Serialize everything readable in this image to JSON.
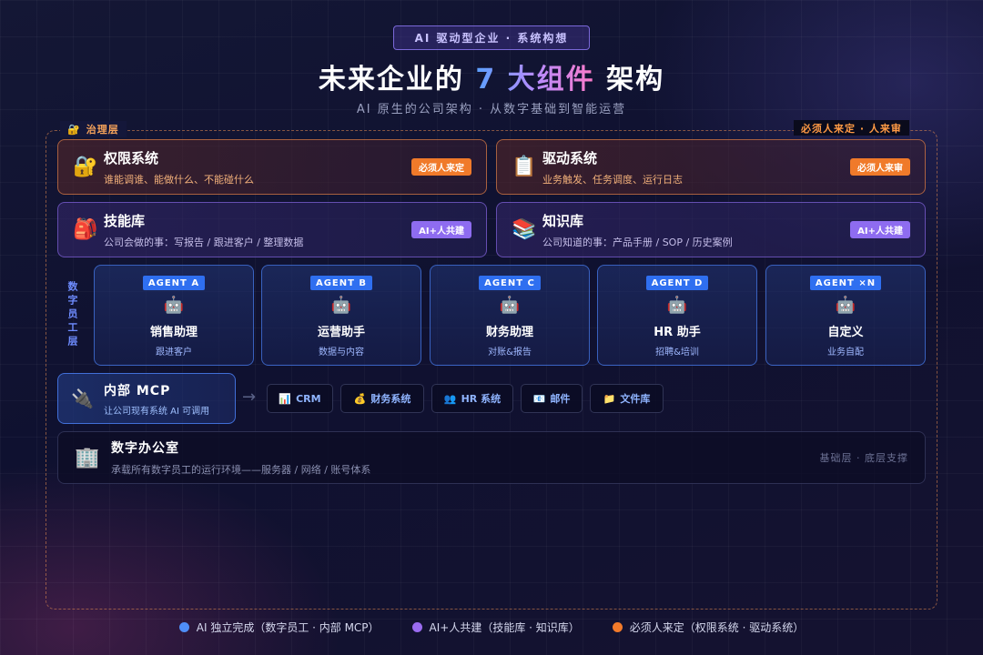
{
  "header": {
    "tag": "AI 驱动型企业 · 系统构想",
    "title_pre": "未来企业的 ",
    "title_highlight": "7 大组件",
    "title_post": " 架构",
    "subtitle": "AI 原生的公司架构 · 从数字基础到智能运营"
  },
  "governance": {
    "label": "治理层",
    "icon": "lock-key-icon",
    "note": "必须人来定 · 人来审",
    "cards": [
      {
        "icon": "🔐",
        "name": "权限系统",
        "desc": "谁能调谁、能做什么、不能碰什么",
        "badge": "必须人来定"
      },
      {
        "icon": "📋",
        "name": "驱动系统",
        "desc": "业务触发、任务调度、运行日志",
        "badge": "必须人来审"
      }
    ]
  },
  "knowledge": {
    "cards": [
      {
        "icon": "🎒",
        "name": "技能库",
        "desc": "公司会做的事：写报告 / 跟进客户 / 整理数据",
        "badge": "AI+人共建"
      },
      {
        "icon": "📚",
        "name": "知识库",
        "desc": "公司知道的事：产品手册 / SOP / 历史案例",
        "badge": "AI+人共建"
      }
    ]
  },
  "agents": {
    "layer_label": "数字员工层",
    "items": [
      {
        "tag": "AGENT A",
        "icon": "🤖",
        "name": "销售助理",
        "desc": "跟进客户"
      },
      {
        "tag": "AGENT B",
        "icon": "🤖",
        "name": "运营助手",
        "desc": "数据与内容"
      },
      {
        "tag": "AGENT C",
        "icon": "🤖",
        "name": "财务助理",
        "desc": "对账&报告"
      },
      {
        "tag": "AGENT D",
        "icon": "🤖",
        "name": "HR 助手",
        "desc": "招聘&培训"
      },
      {
        "tag": "AGENT ×N",
        "icon": "🤖",
        "name": "自定义",
        "desc": "业务自配"
      }
    ]
  },
  "mcp": {
    "icon": "🔌",
    "name": "内部 MCP",
    "desc": "让公司现有系统 AI 可调用",
    "arrow": "→",
    "tools": [
      {
        "icon": "📊",
        "label": "CRM"
      },
      {
        "icon": "💰",
        "label": "财务系统"
      },
      {
        "icon": "👥",
        "label": "HR 系统"
      },
      {
        "icon": "📧",
        "label": "邮件"
      },
      {
        "icon": "📁",
        "label": "文件库"
      }
    ]
  },
  "office": {
    "icon": "🏢",
    "name": "数字办公室",
    "desc": "承载所有数字员工的运行环境——服务器 / 网络 / 账号体系",
    "note": "基础层 · 底层支撑"
  },
  "legend": [
    {
      "color": "#4f8ef7",
      "label": "AI 独立完成（数字员工 · 内部 MCP）"
    },
    {
      "color": "#9a6cf0",
      "label": "AI+人共建（技能库 · 知识库）"
    },
    {
      "color": "#f27a2a",
      "label": "必须人来定（权限系统 · 驱动系统）"
    }
  ]
}
